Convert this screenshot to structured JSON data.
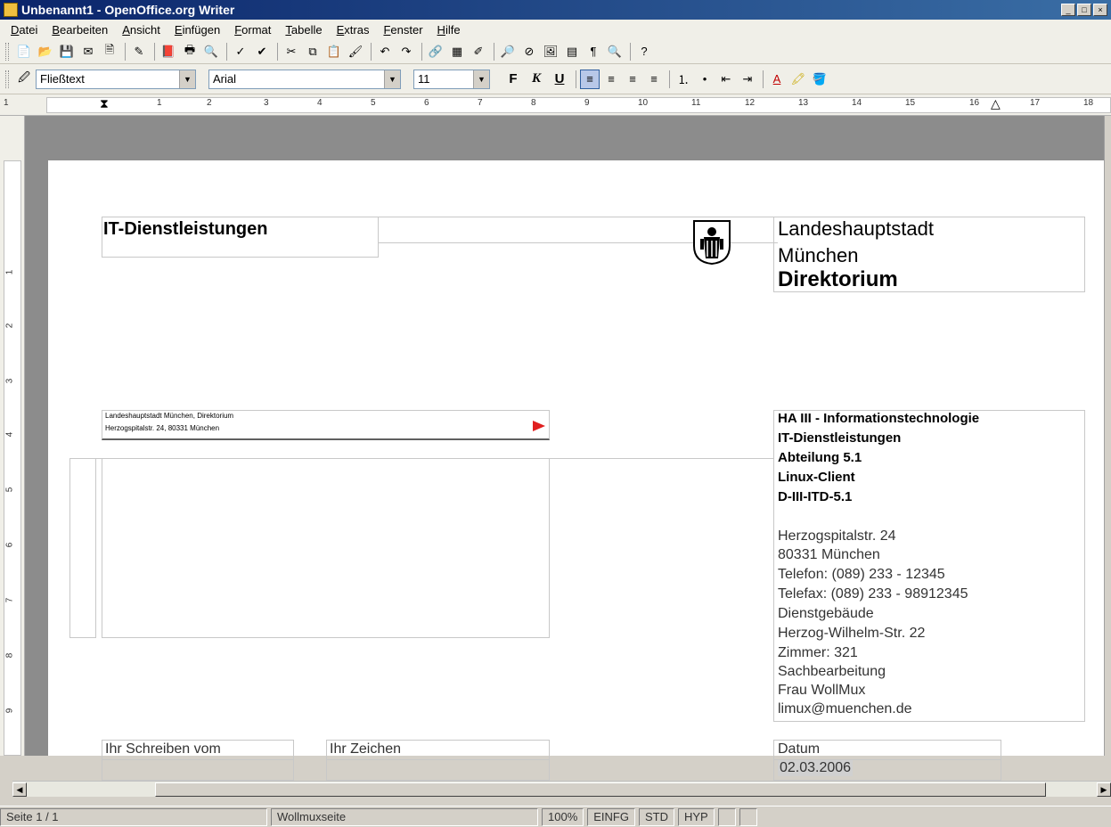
{
  "window": {
    "title": "Unbenannt1 - OpenOffice.org Writer"
  },
  "menu": [
    "Datei",
    "Bearbeiten",
    "Ansicht",
    "Einfügen",
    "Format",
    "Tabelle",
    "Extras",
    "Fenster",
    "Hilfe"
  ],
  "formatting": {
    "paragraph_style": "Fließtext",
    "font_name": "Arial",
    "font_size": "11",
    "bold_label": "F",
    "italic_label": "K",
    "underline_label": "U"
  },
  "ruler": {
    "ticks": [
      "1",
      "1",
      "2",
      "3",
      "4",
      "5",
      "6",
      "7",
      "8",
      "9",
      "10",
      "11",
      "12",
      "13",
      "14",
      "15",
      "16",
      "17",
      "18"
    ],
    "vticks": [
      "1",
      "2",
      "3",
      "4",
      "5",
      "6",
      "7",
      "8",
      "9"
    ]
  },
  "letterhead": {
    "department_title": "IT-Dienstleistungen",
    "city_line1": "Landeshauptstadt",
    "city_line2": "München",
    "office": "Direktorium"
  },
  "sender_line": {
    "line1": "Landeshauptstadt München, Direktorium",
    "line2": "Herzogspitalstr. 24, 80331 München"
  },
  "contact": {
    "dept": [
      "HA III - Informationstechnologie",
      "IT-Dienstleistungen",
      "Abteilung 5.1",
      "Linux-Client",
      "D-III-ITD-5.1"
    ],
    "address": [
      "Herzogspitalstr. 24",
      "80331 München",
      "Telefon: (089) 233 - 12345",
      "Telefax: (089) 233 - 98912345",
      "Dienstgebäude",
      "Herzog-Wilhelm-Str. 22",
      "Zimmer: 321",
      "Sachbearbeitung",
      "Frau WollMux",
      "limux@muenchen.de"
    ]
  },
  "reference_fields": {
    "your_letter_label": "Ihr Schreiben vom",
    "your_ref_label": "Ihr Zeichen",
    "date_label": "Datum",
    "date_value": "02.03.2006"
  },
  "status": {
    "page": "Seite 1 / 1",
    "page_style": "Wollmuxseite",
    "zoom": "100%",
    "insert_mode": "EINFG",
    "selection_mode": "STD",
    "hyperlink_mode": "HYP"
  }
}
